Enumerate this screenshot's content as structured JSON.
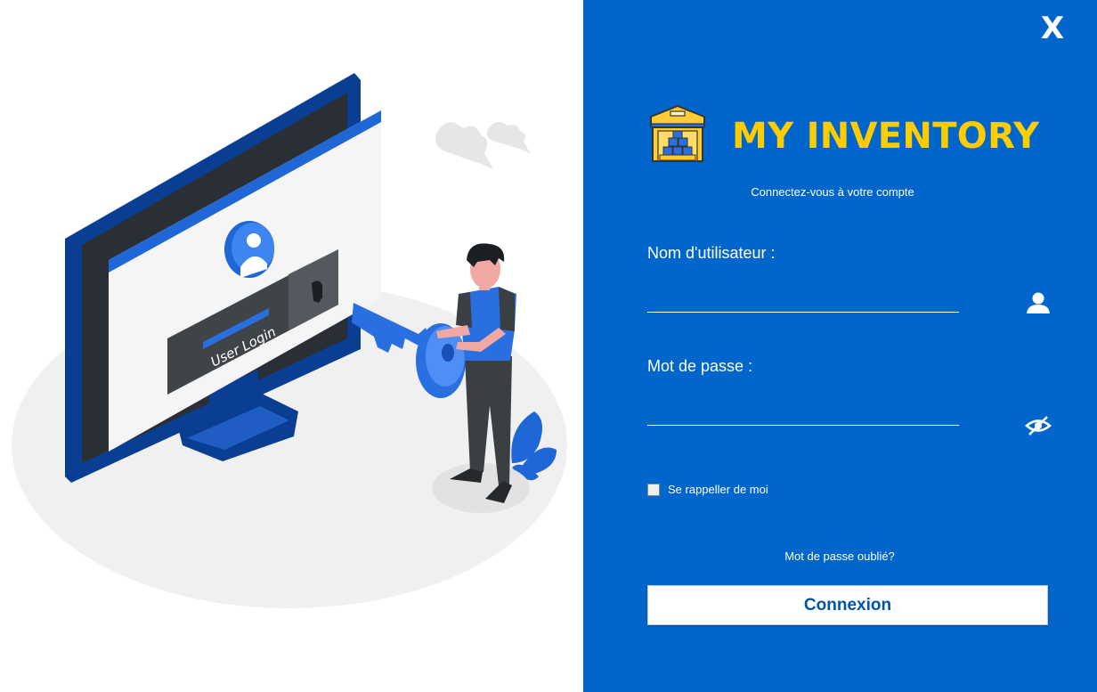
{
  "window": {
    "close_label": "X"
  },
  "illustration": {
    "screen_text": "User Login"
  },
  "brand": {
    "name": "MY INVENTORY",
    "logo_icon": "warehouse-icon"
  },
  "login": {
    "subtitle": "Connectez-vous à votre compte",
    "username_label": "Nom d'utilisateur :",
    "username_value": "",
    "username_icon": "user-icon",
    "password_label": "Mot de passe :",
    "password_value": "",
    "password_icon": "eye-slash-icon",
    "remember_label": "Se rappeller de moi",
    "remember_checked": false,
    "forgot_label": "Mot de passe oublié?",
    "submit_label": "Connexion"
  },
  "colors": {
    "panel": "#0066cc",
    "accent": "#ffcc00",
    "text": "#ffffff",
    "button_text": "#0055aa"
  }
}
